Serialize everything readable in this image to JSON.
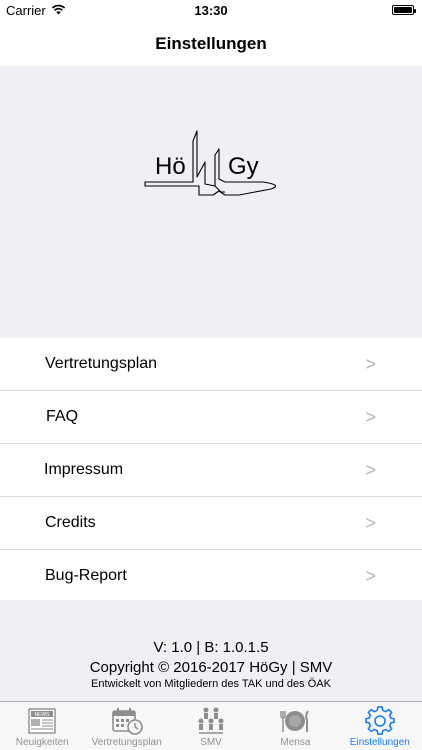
{
  "status_bar": {
    "carrier": "Carrier",
    "time": "13:30"
  },
  "nav": {
    "title": "Einstellungen"
  },
  "logo": {
    "left_text": "Hö",
    "right_text": "Gy"
  },
  "menu": {
    "items": [
      {
        "label": "Vertretungsplan",
        "chevron": ">"
      },
      {
        "label": "FAQ",
        "chevron": ">"
      },
      {
        "label": "Impressum",
        "chevron": ">"
      },
      {
        "label": "Credits",
        "chevron": ">"
      },
      {
        "label": "Bug-Report",
        "chevron": ">"
      }
    ]
  },
  "footer": {
    "version": "V: 1.0 | B: 1.0.1.5",
    "copyright": "Copyright © 2016-2017 HöGy | SMV",
    "developer": "Entwickelt von Mitgliedern des TAK und des ÖAK"
  },
  "tabs": [
    {
      "label": "Neuigkeiten",
      "icon": "newspaper-icon",
      "active": false
    },
    {
      "label": "Vertretungsplan",
      "icon": "calendar-clock-icon",
      "active": false
    },
    {
      "label": "SMV",
      "icon": "people-icon",
      "active": false
    },
    {
      "label": "Mensa",
      "icon": "plate-cutlery-icon",
      "active": false
    },
    {
      "label": "Einstellungen",
      "icon": "gear-icon",
      "active": true
    }
  ],
  "colors": {
    "accent": "#1a7cf5",
    "inactive": "#929292",
    "background": "#efeff4"
  }
}
